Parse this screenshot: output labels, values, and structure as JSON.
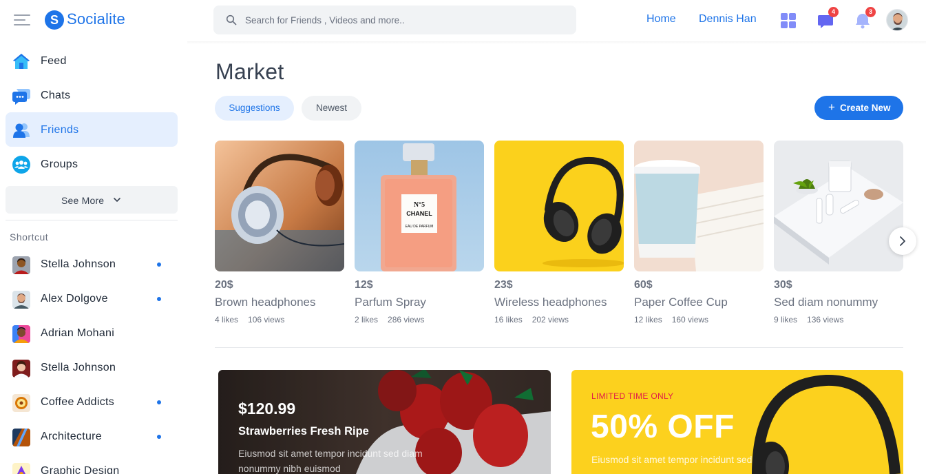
{
  "app": {
    "logo_letter": "S",
    "name": "Socialite"
  },
  "header": {
    "search_placeholder": "Search for Friends , Videos and more..",
    "nav": {
      "home": "Home",
      "user": "Dennis Han"
    },
    "messages_badge": "4",
    "notifications_badge": "3"
  },
  "sidebar": {
    "items": [
      {
        "label": "Feed",
        "icon": "home-icon"
      },
      {
        "label": "Chats",
        "icon": "chat-icon"
      },
      {
        "label": "Friends",
        "icon": "friends-icon",
        "active": true
      },
      {
        "label": "Groups",
        "icon": "groups-icon"
      }
    ],
    "see_more": "See More",
    "shortcut_title": "Shortcut",
    "shortcuts": [
      {
        "label": "Stella Johnson",
        "online": true
      },
      {
        "label": "Alex Dolgove",
        "online": true
      },
      {
        "label": "Adrian Mohani",
        "online": false
      },
      {
        "label": "Stella Johnson",
        "online": false
      },
      {
        "label": "Coffee Addicts",
        "online": true
      },
      {
        "label": "Architecture",
        "online": true
      },
      {
        "label": "Graphic Design",
        "online": false
      }
    ]
  },
  "main": {
    "title": "Market",
    "tabs": {
      "suggestions": "Suggestions",
      "newest": "Newest"
    },
    "create_button": "Create New",
    "products": [
      {
        "price": "20$",
        "name": "Brown headphones",
        "likes": "4 likes",
        "views": "106 views"
      },
      {
        "price": "12$",
        "name": "Parfum Spray",
        "likes": "2 likes",
        "views": "286 views",
        "bottle_text_1": "N°5",
        "bottle_text_2": "CHANEL",
        "bottle_text_3": "EAU DE PARFUM"
      },
      {
        "price": "23$",
        "name": "Wireless headphones",
        "likes": "16 likes",
        "views": "202 views"
      },
      {
        "price": "60$",
        "name": "Paper Coffee Cup",
        "likes": "12 likes",
        "views": "160 views"
      },
      {
        "price": "30$",
        "name": "Sed diam nonummy",
        "likes": "9 likes",
        "views": "136 views"
      }
    ],
    "promo_left": {
      "price": "$120.99",
      "title": "Strawberries Fresh Ripe",
      "description": "Eiusmod sit amet tempor incidunt sed diam nonummy nibh euismod"
    },
    "promo_right": {
      "kicker": "LIMITED TIME ONLY",
      "headline": "50% OFF",
      "description": "Eiusmod sit amet tempor incidunt sed"
    }
  },
  "colors": {
    "accent": "#1e74e8",
    "badge": "#ef4444",
    "promo_yellow": "#fcd11e"
  }
}
